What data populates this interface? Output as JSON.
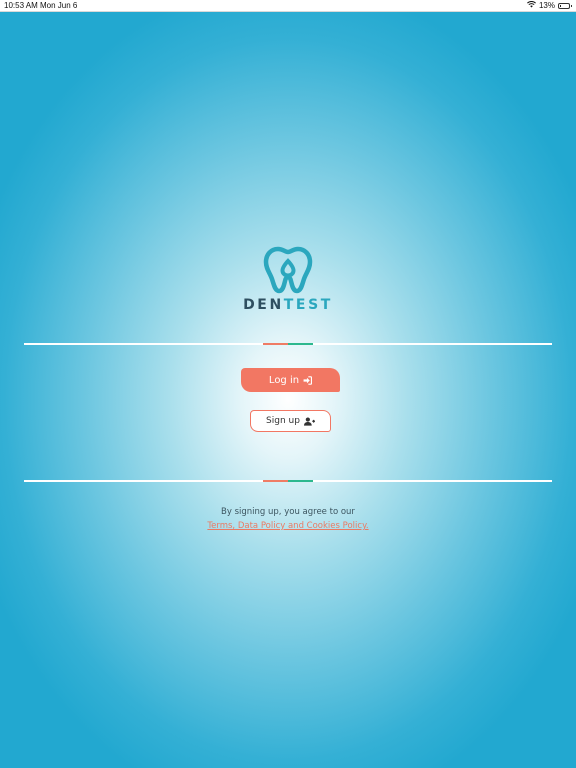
{
  "status_bar": {
    "time": "10:53 AM",
    "date": "Mon Jun 6",
    "battery_percent": "13%",
    "battery_level": 0.13,
    "icons": [
      "wifi-icon",
      "battery-icon"
    ]
  },
  "brand": {
    "name_part1": "DEN",
    "name_part2": "TEST",
    "logo_icon": "tooth-logo-icon",
    "colors": {
      "dark": "#2e4f60",
      "teal": "#2ba7be",
      "orange": "#f27763",
      "green": "#2db88e"
    }
  },
  "actions": {
    "login_label": "Log in",
    "login_icon": "sign-in-icon",
    "signup_label": "Sign up",
    "signup_icon": "user-plus-icon"
  },
  "legal": {
    "text": "By signing up, you agree to our",
    "link": "Terms, Data Policy and Cookies Policy."
  }
}
